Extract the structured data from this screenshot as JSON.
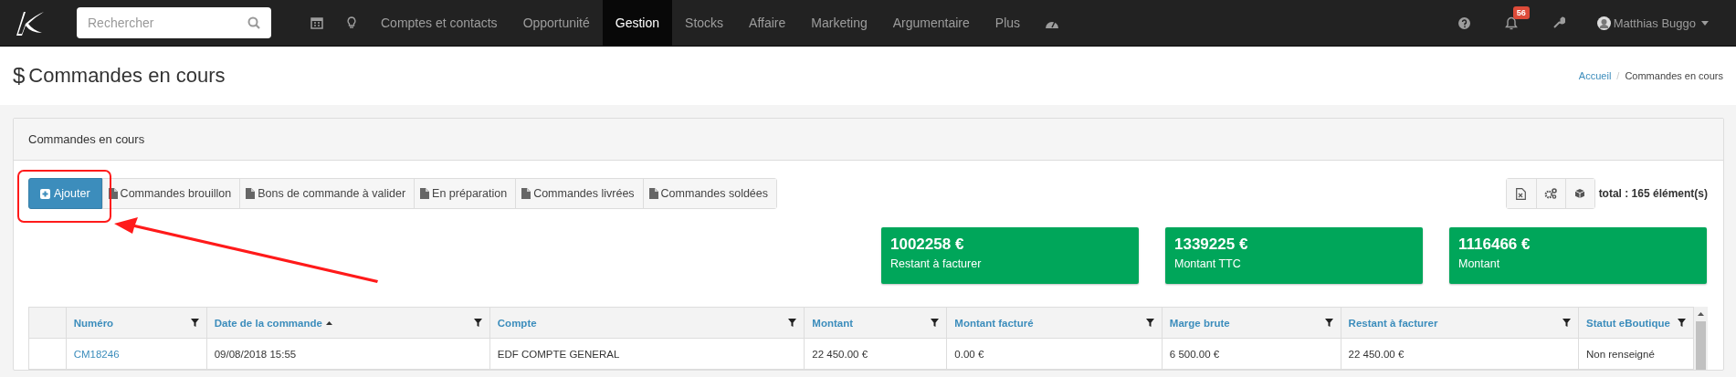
{
  "nav": {
    "search": {
      "placeholder": "Rechercher"
    },
    "items": [
      {
        "label": "Comptes et contacts",
        "selected": false
      },
      {
        "label": "Opportunité",
        "selected": false
      },
      {
        "label": "Gestion",
        "selected": true
      },
      {
        "label": "Stocks",
        "selected": false
      },
      {
        "label": "Affaire",
        "selected": false
      },
      {
        "label": "Marketing",
        "selected": false
      },
      {
        "label": "Argumentaire",
        "selected": false
      },
      {
        "label": "Plus",
        "selected": false
      }
    ],
    "notifications": {
      "badge": "56"
    },
    "user": {
      "name": "Matthias Buggo"
    }
  },
  "page": {
    "icon": "$",
    "title": "Commandes en cours",
    "breadcrumb": {
      "items": [
        "Accueil",
        "Commandes en cours"
      ],
      "separator": "/"
    }
  },
  "panel": {
    "title": "Commandes en cours",
    "buttons": [
      {
        "kind": "primary",
        "label": "Ajouter"
      },
      {
        "kind": "view",
        "label": "Commandes brouillon"
      },
      {
        "kind": "view",
        "label": "Bons de commande à valider"
      },
      {
        "kind": "view",
        "label": "En préparation"
      },
      {
        "kind": "view",
        "label": "Commandes livrées"
      },
      {
        "kind": "view",
        "label": "Commandes soldées"
      }
    ],
    "total": "total : 165 élément(s)",
    "cards": [
      {
        "value": "1002258 €",
        "label": "Restant à facturer"
      },
      {
        "value": "1339225 €",
        "label": "Montant TTC"
      },
      {
        "value": "1116466 €",
        "label": "Montant"
      }
    ],
    "table": {
      "columns": [
        {
          "label": "Numéro",
          "kind": "link",
          "sorted": false
        },
        {
          "label": "Date de la commande",
          "kind": "text",
          "sorted": true
        },
        {
          "label": "Compte",
          "kind": "text",
          "sorted": false
        },
        {
          "label": "Montant",
          "kind": "text",
          "sorted": false
        },
        {
          "label": "Montant facturé",
          "kind": "text",
          "sorted": false
        },
        {
          "label": "Marge brute",
          "kind": "text",
          "sorted": false
        },
        {
          "label": "Restant à facturer",
          "kind": "text",
          "sorted": false
        },
        {
          "label": "Statut eBoutique",
          "kind": "text",
          "sorted": false
        }
      ],
      "rows": [
        [
          "CM18246",
          "09/08/2018 15:55",
          "EDF COMPTE GENERAL",
          "22 450.00 €",
          "0.00 €",
          "6 500.00 €",
          "22 450.00 €",
          "Non renseigné"
        ]
      ]
    }
  }
}
